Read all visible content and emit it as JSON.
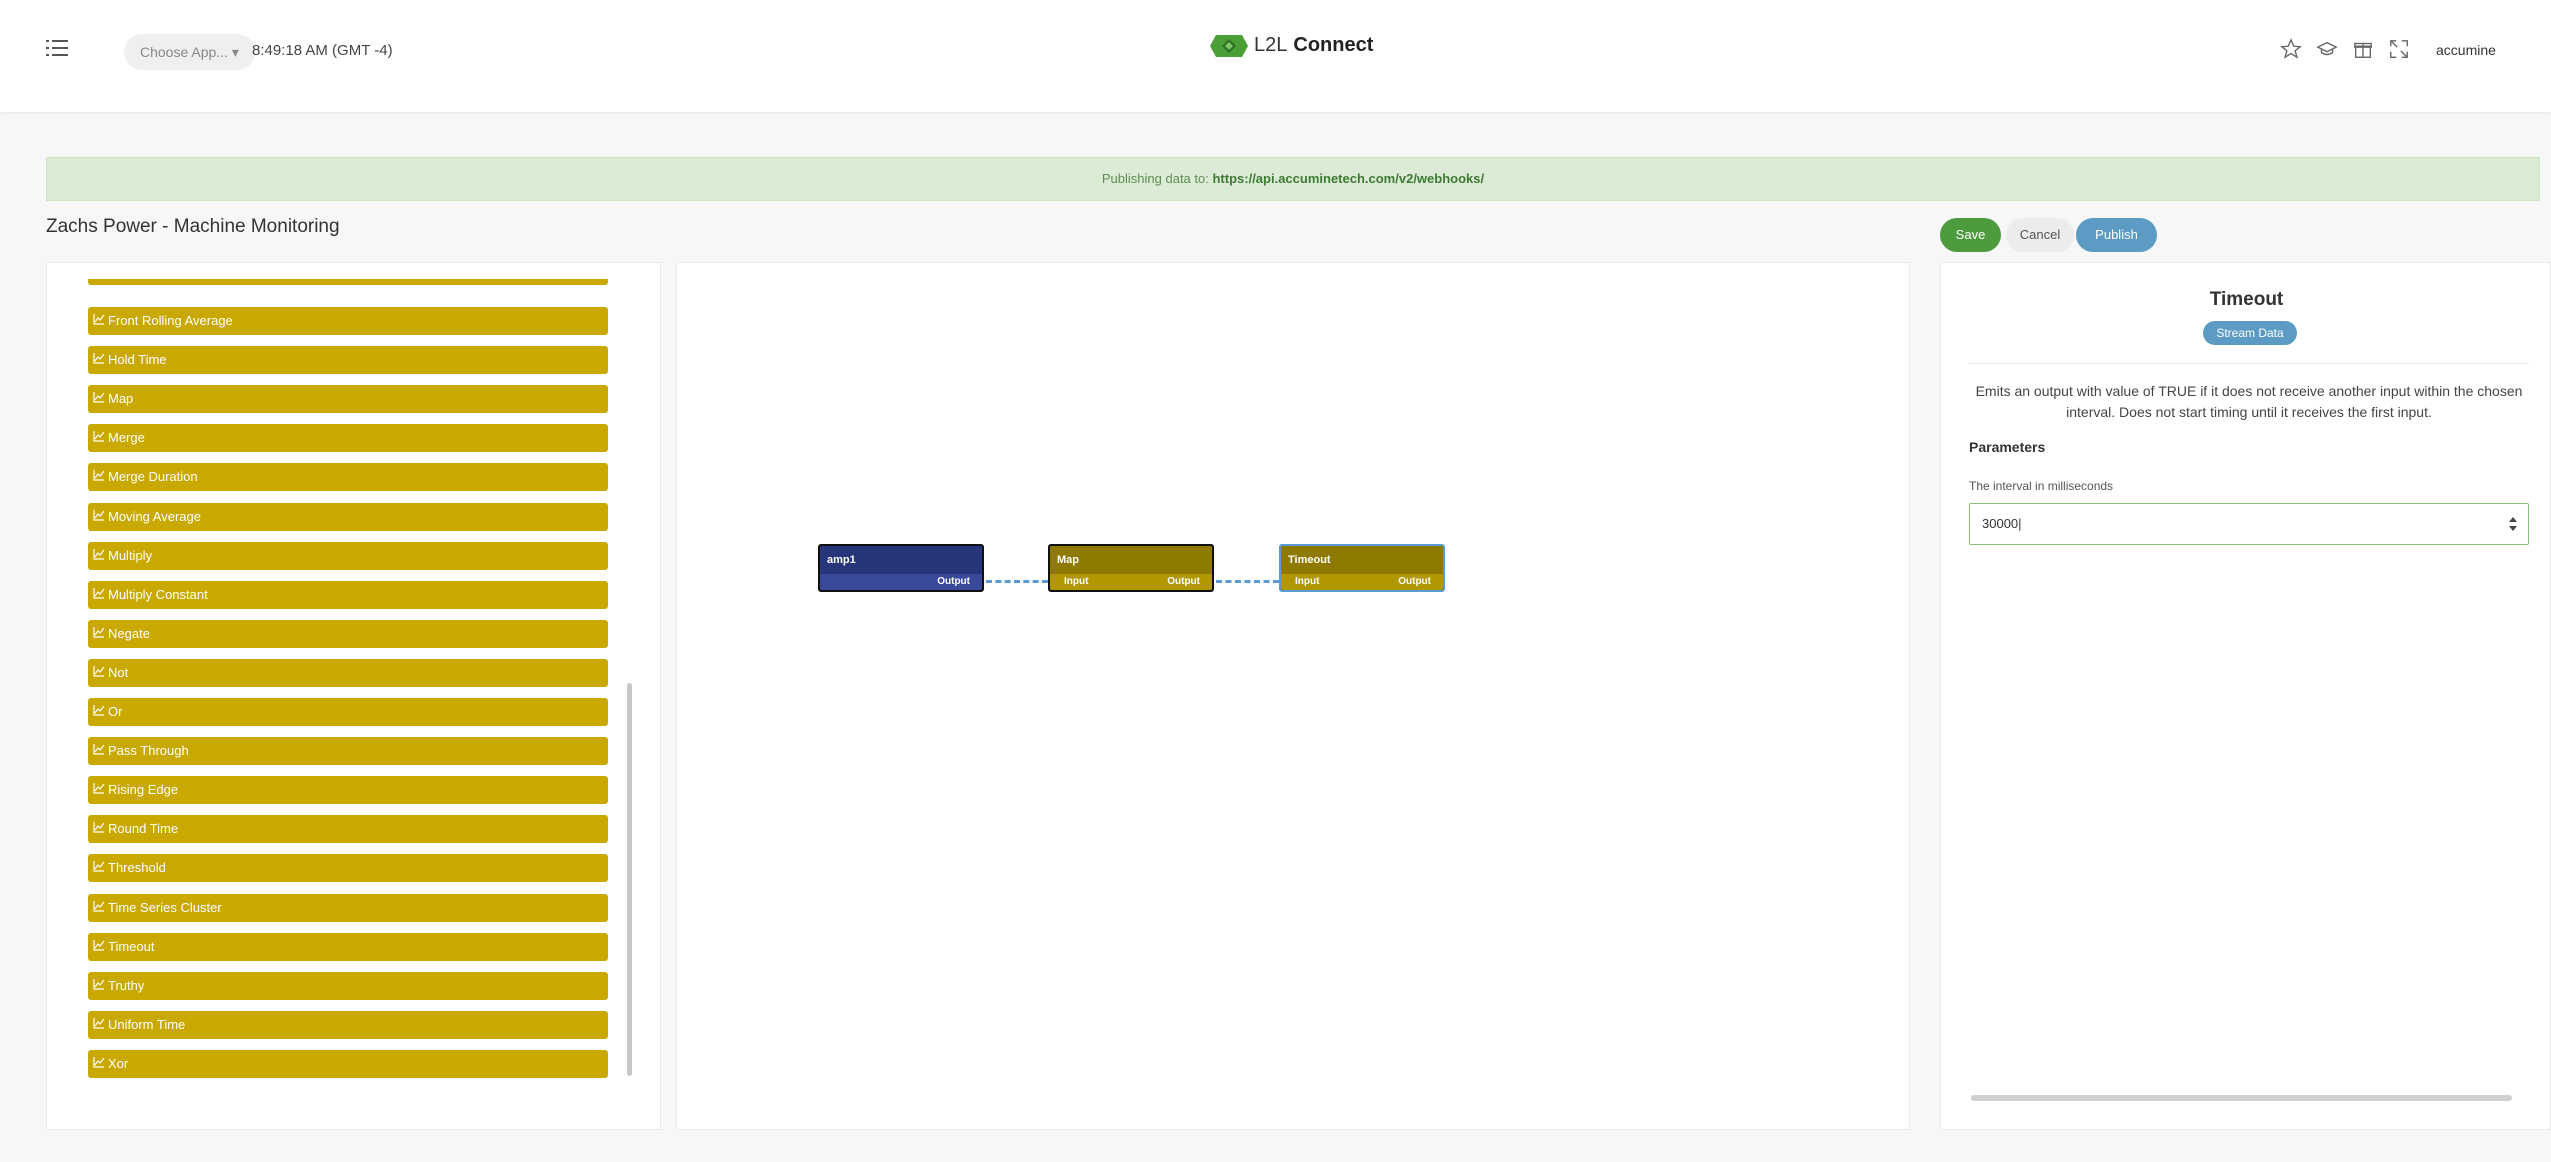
{
  "header": {
    "app_select_label": "Choose App...",
    "clock": "8:49:18 AM (GMT -4)",
    "brand_l2l": "L2L",
    "brand_connect": "Connect",
    "user_name": "accumine",
    "icons": [
      "star-icon",
      "graduation-cap-icon",
      "gift-icon",
      "fullscreen-icon"
    ]
  },
  "banner": {
    "prefix": "Publishing data to:",
    "url": "https://api.accuminetech.com/v2/webhooks/"
  },
  "page": {
    "title": "Zachs Power - Machine Monitoring"
  },
  "actions": {
    "save": "Save",
    "cancel": "Cancel",
    "publish": "Publish"
  },
  "node_list": [
    "Front Rolling Average",
    "Hold Time",
    "Map",
    "Merge",
    "Merge Duration",
    "Moving Average",
    "Multiply",
    "Multiply Constant",
    "Negate",
    "Not",
    "Or",
    "Pass Through",
    "Rising Edge",
    "Round Time",
    "Threshold",
    "Time Series Cluster",
    "Timeout",
    "Truthy",
    "Uniform Time",
    "Xor"
  ],
  "canvas": {
    "nodes": [
      {
        "title": "amp1",
        "input": "",
        "output": "Output"
      },
      {
        "title": "Map",
        "input": "Input",
        "output": "Output"
      },
      {
        "title": "Timeout",
        "input": "Input",
        "output": "Output"
      }
    ]
  },
  "details": {
    "title": "Timeout",
    "badge": "Stream Data",
    "description": "Emits an output with value of TRUE if it does not receive another input within the chosen interval. Does not start timing until it receives the first input.",
    "parameters_heading": "Parameters",
    "interval_label": "The interval in milliseconds",
    "interval_value": "30000"
  },
  "colors": {
    "accent_green": "#4e9a3f",
    "accent_blue": "#5b9bc4",
    "node_yellow": "#c9a800",
    "node_navy": "#27357a"
  }
}
